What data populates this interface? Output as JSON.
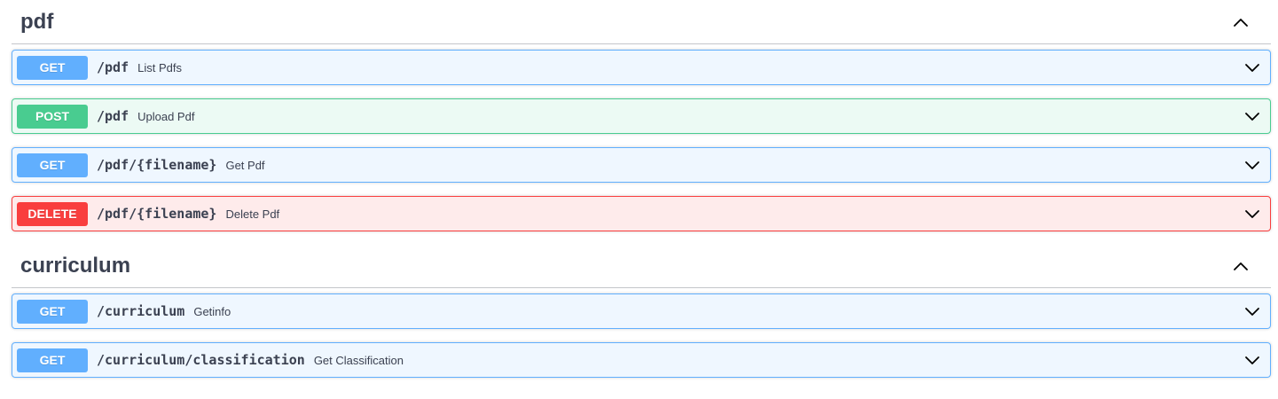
{
  "sections": [
    {
      "name": "pdf",
      "operations": [
        {
          "method": "GET",
          "path": "/pdf",
          "summary": "List Pdfs"
        },
        {
          "method": "POST",
          "path": "/pdf",
          "summary": "Upload Pdf"
        },
        {
          "method": "GET",
          "path": "/pdf/{filename}",
          "summary": "Get Pdf"
        },
        {
          "method": "DELETE",
          "path": "/pdf/{filename}",
          "summary": "Delete Pdf"
        }
      ]
    },
    {
      "name": "curriculum",
      "operations": [
        {
          "method": "GET",
          "path": "/curriculum",
          "summary": "Getinfo"
        },
        {
          "method": "GET",
          "path": "/curriculum/classification",
          "summary": "Get Classification"
        }
      ]
    }
  ],
  "colors": {
    "get": "#61affe",
    "post": "#49cc90",
    "delete": "#f93e3e",
    "text": "#3b4151"
  },
  "icons": {
    "section_toggle": "chevron-up-icon",
    "operation_toggle": "chevron-down-icon"
  }
}
